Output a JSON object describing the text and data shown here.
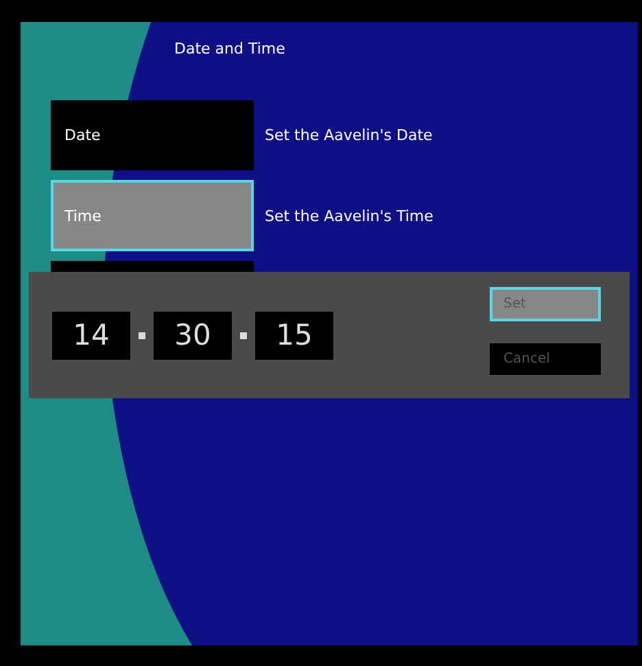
{
  "screen": {
    "title": "Date and Time"
  },
  "menu": [
    {
      "label": "Date",
      "description": "Set the Aavelin's Date",
      "selected": false
    },
    {
      "label": "Time",
      "description": "Set the Aavelin's Time",
      "selected": true
    }
  ],
  "dialog": {
    "fields": [
      {
        "value": "14"
      },
      {
        "value": "30"
      },
      {
        "value": "15"
      }
    ],
    "buttons": [
      {
        "label": "Set",
        "selected": true
      },
      {
        "label": "Cancel",
        "selected": false
      }
    ]
  }
}
